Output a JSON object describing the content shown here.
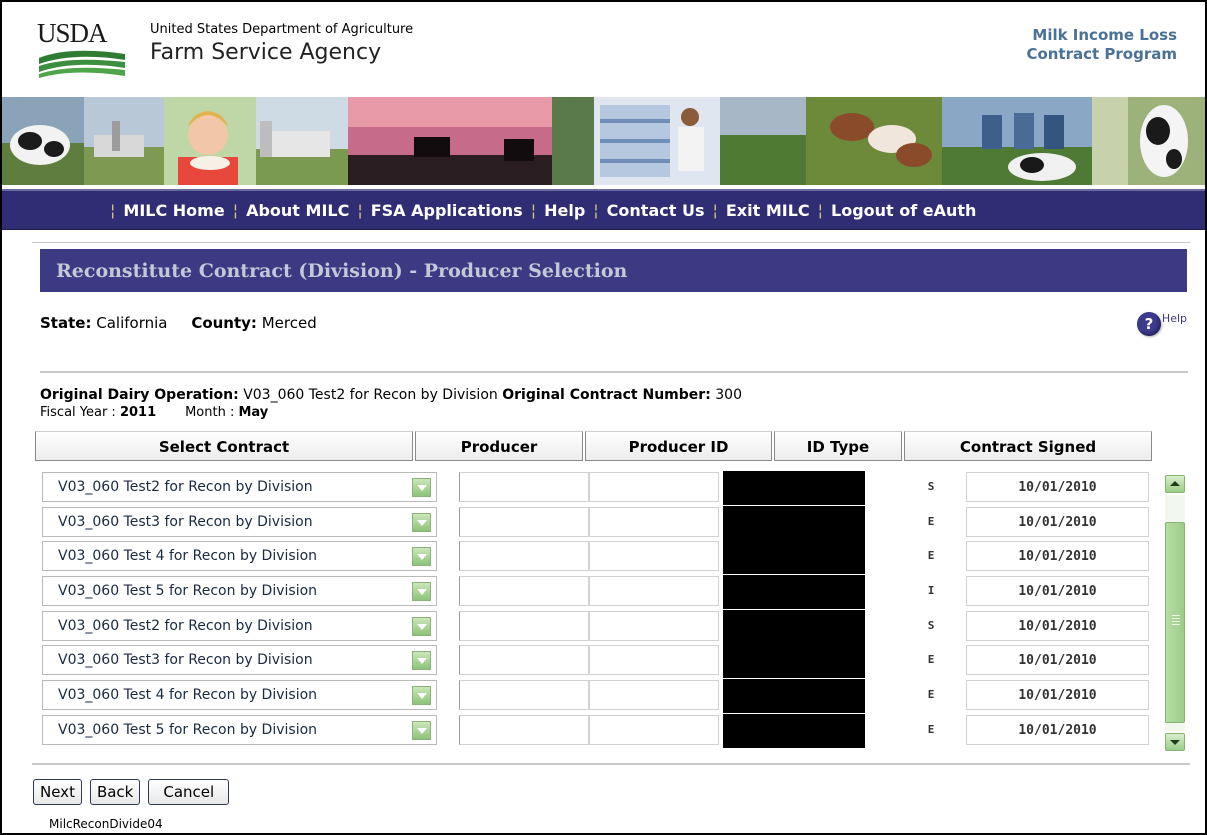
{
  "header": {
    "logo_text": "USDA",
    "department": "United States Department of Agriculture",
    "agency": "Farm Service Agency",
    "program_line1": "Milk Income Loss",
    "program_line2": "Contract Program"
  },
  "nav": {
    "items": [
      "MILC Home",
      "About MILC",
      "FSA Applications",
      "Help",
      "Contact Us",
      "Exit MILC",
      "Logout of eAuth"
    ]
  },
  "page": {
    "heading": "Reconstitute Contract (Division) - Producer Selection",
    "state_label": "State:",
    "state_value": "California",
    "county_label": "County:",
    "county_value": "Merced",
    "help_label": "Help",
    "orig_op_label": "Original Dairy Operation:",
    "orig_op_value": "V03_060 Test2 for Recon by Division",
    "orig_contract_label": "Original Contract Number:",
    "orig_contract_value": "300",
    "fiscal_year_label": "Fiscal Year :",
    "fiscal_year_value": "2011",
    "month_label": "Month :",
    "month_value": "May",
    "page_id": "MilcReconDivide04"
  },
  "table": {
    "headers": [
      "Select Contract",
      "Producer",
      "Producer ID",
      "ID Type",
      "Contract Signed"
    ],
    "rows": [
      {
        "contract": "V03_060 Test2 for Recon by Division",
        "id_type": "S",
        "signed": "10/01/2010"
      },
      {
        "contract": "V03_060 Test3 for Recon by Division",
        "id_type": "E",
        "signed": "10/01/2010"
      },
      {
        "contract": "V03_060 Test 4 for Recon by Division",
        "id_type": "E",
        "signed": "10/01/2010"
      },
      {
        "contract": "V03_060 Test 5 for Recon by Division",
        "id_type": "I",
        "signed": "10/01/2010"
      },
      {
        "contract": "V03_060 Test2 for Recon by Division",
        "id_type": "S",
        "signed": "10/01/2010"
      },
      {
        "contract": "V03_060 Test3 for Recon by Division",
        "id_type": "E",
        "signed": "10/01/2010"
      },
      {
        "contract": "V03_060 Test 4 for Recon by Division",
        "id_type": "E",
        "signed": "10/01/2010"
      },
      {
        "contract": "V03_060 Test 5 for Recon by Division",
        "id_type": "E",
        "signed": "10/01/2010"
      }
    ]
  },
  "buttons": {
    "next": "Next",
    "back": "Back",
    "cancel": "Cancel"
  },
  "colors": {
    "nav_bg": "#2f2d74",
    "heading_bg": "#3b3a83",
    "program_title": "#4a7296",
    "dropdown_green": "#8ec27a"
  }
}
